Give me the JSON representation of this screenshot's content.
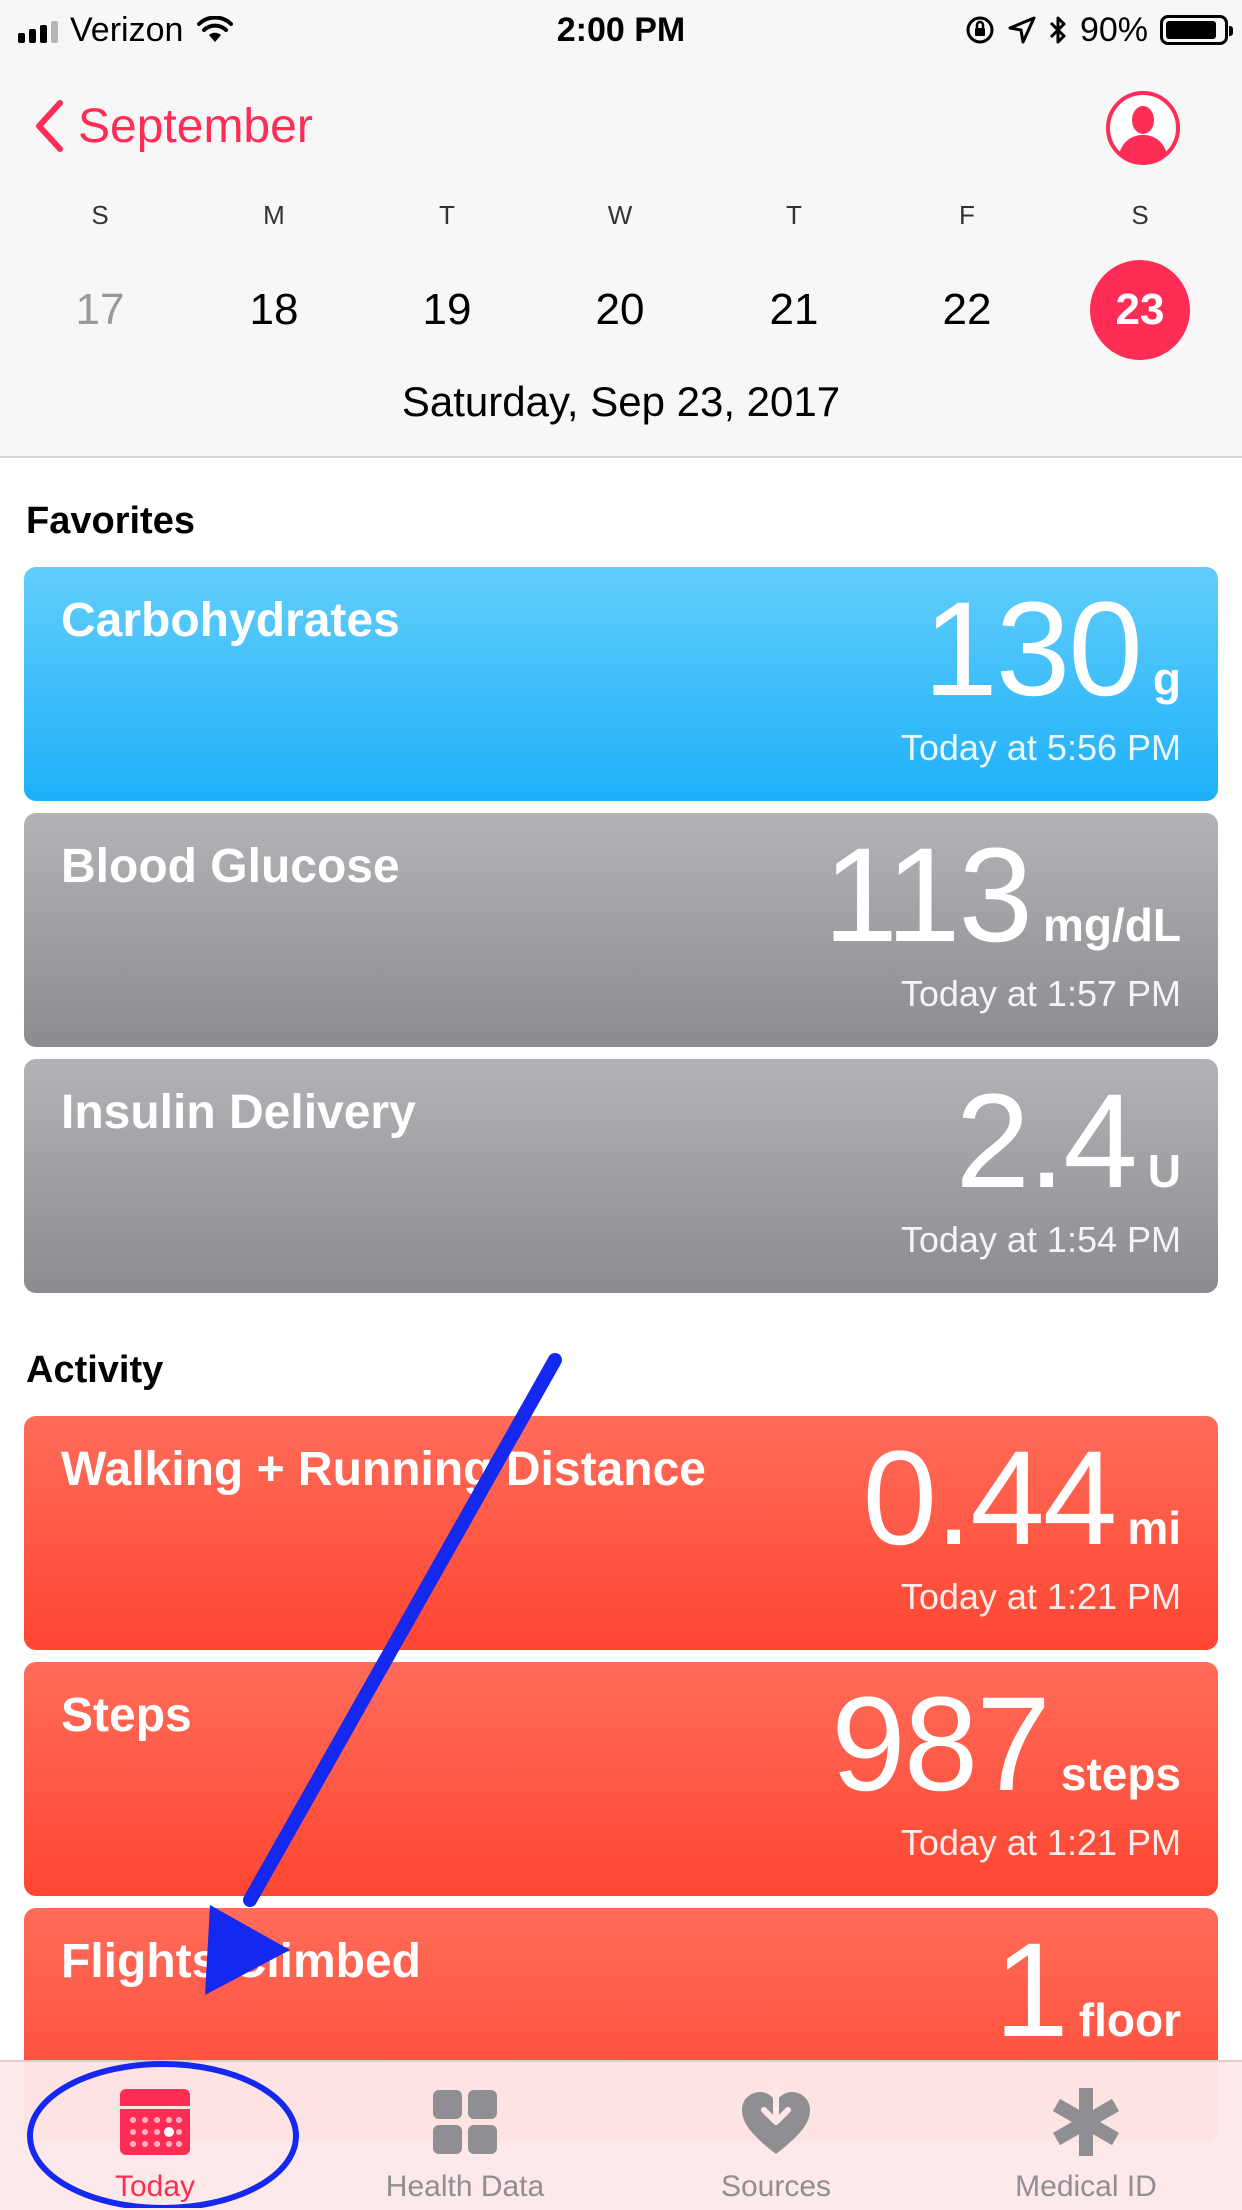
{
  "status_bar": {
    "carrier": "Verizon",
    "time": "2:00 PM",
    "battery_percent": "90%",
    "battery_level": 0.9
  },
  "header": {
    "back_label": "September",
    "weekdays": [
      "S",
      "M",
      "T",
      "W",
      "T",
      "F",
      "S"
    ],
    "dates": [
      "17",
      "18",
      "19",
      "20",
      "21",
      "22",
      "23"
    ],
    "selected_date": "23",
    "full_date": "Saturday, Sep 23, 2017"
  },
  "favorites": {
    "heading": "Favorites",
    "cards": [
      {
        "title": "Carbohydrates",
        "value": "130",
        "unit": "g",
        "time": "Today at 5:56 PM",
        "color": "#1eb0f9"
      },
      {
        "title": "Blood Glucose",
        "value": "113",
        "unit": "mg/dL",
        "time": "Today at 1:57 PM",
        "color": "#8e8e93"
      },
      {
        "title": "Insulin Delivery",
        "value": "2.4",
        "unit": "U",
        "time": "Today at 1:54 PM",
        "color": "#8e8e93"
      }
    ]
  },
  "activity": {
    "heading": "Activity",
    "cards": [
      {
        "title": "Walking + Running Distance",
        "value": "0.44",
        "unit": "mi",
        "time": "Today at 1:21 PM",
        "color": "#ff4a36"
      },
      {
        "title": "Steps",
        "value": "987",
        "unit": "steps",
        "time": "Today at 1:21 PM",
        "color": "#ff4a36"
      },
      {
        "title": "Flights Climbed",
        "value": "1",
        "unit": "floor",
        "time": "",
        "color": "#ff4a36"
      }
    ]
  },
  "tabbar": {
    "active": "Today",
    "tabs": [
      {
        "label": "Today",
        "icon": "calendar-icon"
      },
      {
        "label": "Health Data",
        "icon": "grid-icon"
      },
      {
        "label": "Sources",
        "icon": "heart-download-icon"
      },
      {
        "label": "Medical ID",
        "icon": "asterisk-icon"
      }
    ]
  },
  "colors": {
    "accent": "#ff2d55",
    "annotation": "#1428f0"
  }
}
